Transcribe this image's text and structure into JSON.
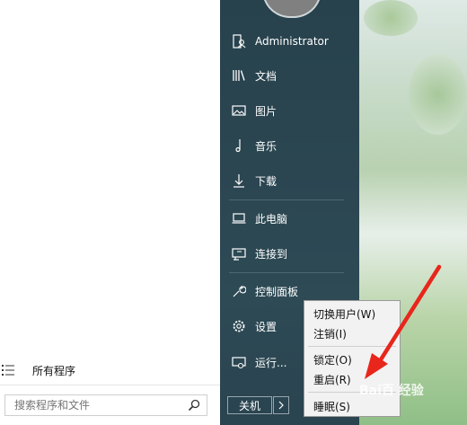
{
  "start_menu": {
    "user": {
      "name": "Administrator"
    },
    "items": [
      {
        "label": "文档",
        "icon": "library-icon"
      },
      {
        "label": "图片",
        "icon": "picture-icon"
      },
      {
        "label": "音乐",
        "icon": "music-note-icon"
      },
      {
        "label": "下载",
        "icon": "download-icon"
      },
      {
        "label": "此电脑",
        "icon": "computer-icon"
      },
      {
        "label": "连接到",
        "icon": "connect-icon"
      },
      {
        "label": "控制面板",
        "icon": "wrench-icon"
      },
      {
        "label": "设置",
        "icon": "gear-icon"
      },
      {
        "label": "运行...",
        "icon": "run-icon"
      }
    ],
    "shutdown_label": "关机",
    "all_programs_label": "所有程序",
    "search_placeholder": "搜索程序和文件"
  },
  "context_menu": {
    "items": [
      "切换用户(W)",
      "注销(I)",
      "锁定(O)",
      "重启(R)",
      "睡眠(S)"
    ]
  },
  "watermark": "Bai百 经验",
  "colors": {
    "panel": "#2b4651",
    "arrow": "#e8261c"
  }
}
